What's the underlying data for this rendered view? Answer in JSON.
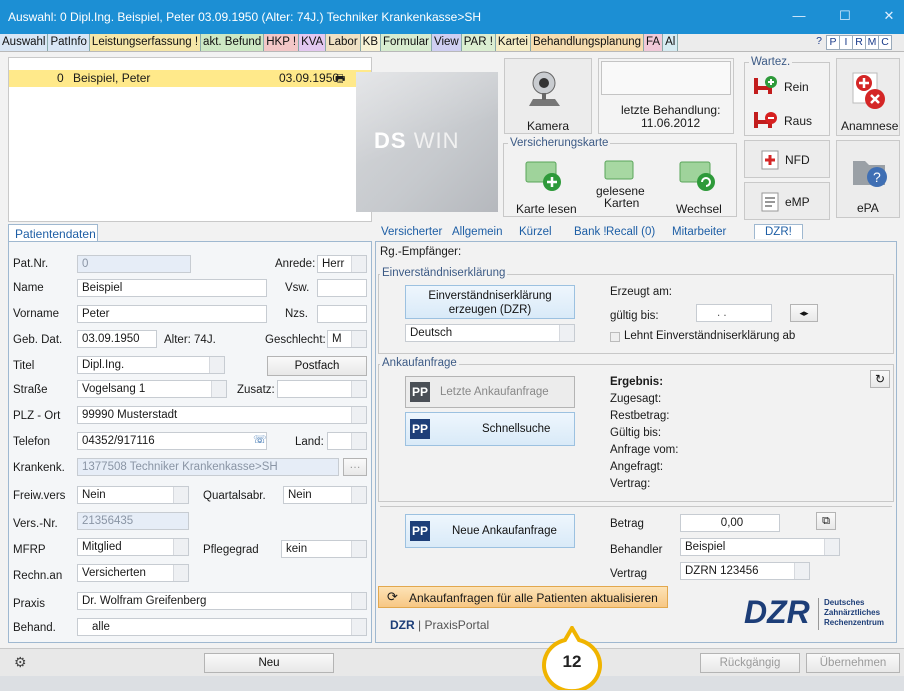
{
  "title_bar": {
    "text": "Auswahl: 0 Dipl.Ing. Beispiel, Peter  03.09.1950 (Alter: 74J.)  Techniker Krankenkasse>SH"
  },
  "menu_tabs": [
    {
      "label": "Auswahl",
      "bg": "#d8e6f5"
    },
    {
      "label": "PatInfo",
      "bg": "#d8e6f5"
    },
    {
      "label": "Leistungserfassung !",
      "bg": "#f5e6a8"
    },
    {
      "label": "akt. Befund",
      "bg": "#cde8c4"
    },
    {
      "label": "HKP !",
      "bg": "#f3c7c7"
    },
    {
      "label": "KVA",
      "bg": "#e3c8f0"
    },
    {
      "label": "Labor",
      "bg": "#efe1c4"
    },
    {
      "label": "KB",
      "bg": "#f7f2d6"
    },
    {
      "label": "Formular",
      "bg": "#d7ecd0"
    },
    {
      "label": "View",
      "bg": "#cfcff2"
    },
    {
      "label": "PAR !",
      "bg": "#dbeed1"
    },
    {
      "label": "Kartei",
      "bg": "#f4ecc5"
    },
    {
      "label": "Behandlungsplanung",
      "bg": "#f6ddb0"
    },
    {
      "label": "FA",
      "bg": "#f0c9d8"
    },
    {
      "label": "Al",
      "bg": "#d6ebf2"
    }
  ],
  "right_tabs": [
    "P",
    "I",
    "R",
    "M",
    "C"
  ],
  "patient_list": {
    "number": "0",
    "name": "Beispiel, Peter",
    "dob": "03.09.1950"
  },
  "logo": {
    "bold": "DS",
    "light": "WIN"
  },
  "kamera": {
    "label": "Kamera"
  },
  "last_treatment": {
    "label": "letzte Behandlung:",
    "date": "11.06.2012"
  },
  "wartez": {
    "label": "Wartez.",
    "rein": "Rein",
    "raus": "Raus"
  },
  "anamnese": {
    "label": "Anamnese"
  },
  "versicherungskarte": {
    "label": "Versicherungskarte",
    "karte_lesen": "Karte lesen",
    "gelesene_line1": "gelesene",
    "gelesene_line2": "Karten",
    "wechsel": "Wechsel"
  },
  "nfd": {
    "label": "NFD"
  },
  "emp": {
    "label": "eMP"
  },
  "epa": {
    "label": "ePA"
  },
  "left_tab": "Patientendaten",
  "patient": {
    "pat_nr_label": "Pat.Nr.",
    "pat_nr": "0",
    "anrede_label": "Anrede:",
    "anrede": "Herr",
    "name_label": "Name",
    "name": "Beispiel",
    "vsw_label": "Vsw.",
    "vsw": "",
    "vorname_label": "Vorname",
    "vorname": "Peter",
    "nzs_label": "Nzs.",
    "nzs": "",
    "geb_label": "Geb. Dat.",
    "geb": "03.09.1950",
    "alter": "Alter: 74J.",
    "geschlecht_label": "Geschlecht:",
    "geschlecht": "M",
    "titel_label": "Titel",
    "titel": "Dipl.Ing.",
    "postfach": "Postfach",
    "strasse_label": "Straße",
    "strasse": "Vogelsang 1",
    "zusatz_label": "Zusatz:",
    "zusatz": "",
    "plz_label": "PLZ - Ort",
    "plz": "99990 Musterstadt",
    "telefon_label": "Telefon",
    "telefon": "04352/917116",
    "land_label": "Land:",
    "land": "",
    "krankenk_label": "Krankenk.",
    "krankenk": "1377508 Techniker Krankenkasse>SH",
    "freiw_label": "Freiw.vers",
    "freiw": "Nein",
    "quartal_label": "Quartalsabr.",
    "quartal": "Nein",
    "versnr_label": "Vers.-Nr.",
    "versnr": "21356435",
    "mfrp_label": "MFRP",
    "mfrp": "Mitglied",
    "pflege_label": "Pflegegrad",
    "pflege": "kein",
    "rechn_label": "Rechn.an",
    "rechn": "Versicherten",
    "praxis_label": "Praxis",
    "praxis": "Dr. Wolfram Greifenberg",
    "behand_label": "Behand.",
    "behand": "alle"
  },
  "right_tabs_row": [
    {
      "label": "Versicherter",
      "active": false
    },
    {
      "label": "Allgemein",
      "active": false
    },
    {
      "label": "Kürzel",
      "active": false
    },
    {
      "label": "Bank !",
      "active": false
    },
    {
      "label": "Recall (0)",
      "active": false
    },
    {
      "label": "Mitarbeiter",
      "active": false
    },
    {
      "label": "DZR!",
      "active": true
    }
  ],
  "dzr": {
    "rg_empfaenger": "Rg.-Empfänger:",
    "einverst_group": "Einverständniserklärung",
    "einverst_btn_line1": "Einverständniserklärung",
    "einverst_btn_line2": "erzeugen (DZR)",
    "erzeugt_am": "Erzeugt am:",
    "gueltig_bis": "gültig bis:",
    "date_placeholder": ".   .",
    "sprache": "Deutsch",
    "lehnt_ab": "Lehnt Einverständniserklärung ab",
    "ankauf_group": "Ankaufanfrage",
    "letzte_btn": "Letzte Ankaufanfrage",
    "schnell_btn": "Schnellsuche",
    "ergebnis": "Ergebnis:",
    "zugesagt": "Zugesagt:",
    "restbetrag": "Restbetrag:",
    "gueltig_bis2": "Gültig bis:",
    "anfrage_vom": "Anfrage vom:",
    "angefragt": "Angefragt:",
    "vertrag_label1": "Vertrag:",
    "neue_btn": "Neue Ankaufanfrage",
    "pp": "PP",
    "betrag_label": "Betrag",
    "betrag": "0,00",
    "behandler_label": "Behandler",
    "behandler": "Beispiel",
    "vertrag_label": "Vertrag",
    "vertrag": "DZRN 123456",
    "update_all_btn": "Ankaufanfragen für alle Patienten aktualisieren",
    "portal_logo": "DZR",
    "portal_text": "PraxisPortal",
    "big_logo": "DZR",
    "big_logo_line1": "Deutsches",
    "big_logo_line2": "Zahnärztliches",
    "big_logo_line3": "Rechenzentrum"
  },
  "footer": {
    "neu": "Neu",
    "rueckgaengig": "Rückgängig",
    "uebernehmen": "Übernehmen"
  },
  "callout": {
    "number": "12",
    "color": "#f0b400"
  }
}
